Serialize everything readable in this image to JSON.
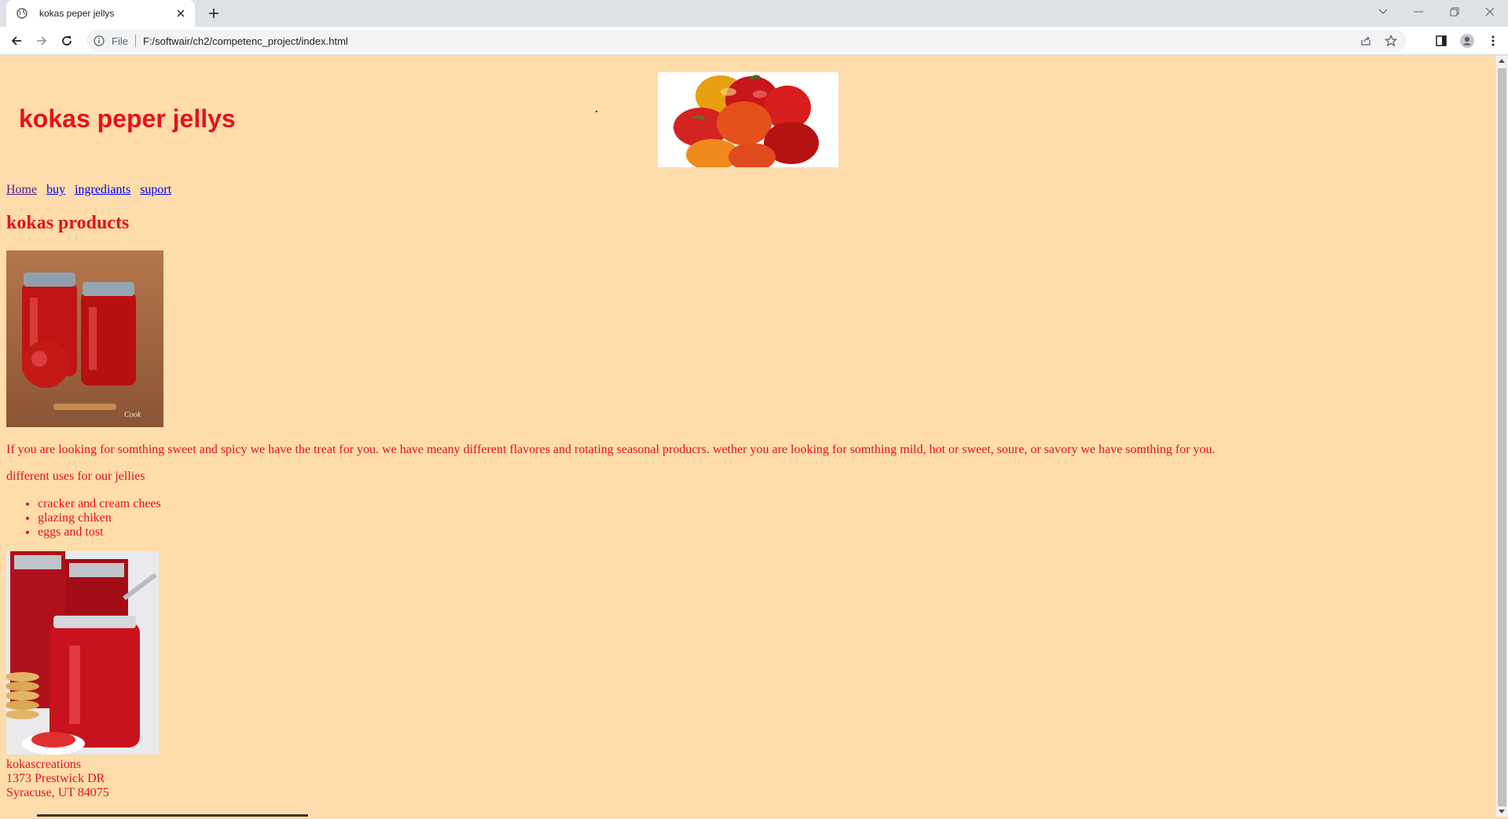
{
  "browser": {
    "tab_title": "kokas peper jellys",
    "url_scheme_label": "File",
    "url": "F:/softwair/ch2/competenc_project/index.html"
  },
  "page": {
    "site_title": "kokas peper jellys",
    "nav": [
      {
        "label": "Home"
      },
      {
        "label": "buy"
      },
      {
        "label": "ingrediants"
      },
      {
        "label": "suport"
      }
    ],
    "products_heading": "kokas products",
    "intro": "If you are looking for somthing sweet and spicy we have the treat for you. we have meany different flavores and rotating seasonal producrs. wether you are looking for somthing mild, hot or sweet, soure, or savory we have somthing for you.",
    "uses_heading": "different uses for our jellies",
    "uses": [
      "cracker and cream chees",
      "glazing chiken",
      "eggs and tost"
    ],
    "address": {
      "name": "kokascreations",
      "street": "1373 Prestwick DR",
      "city": "Syracuse, UT 84075"
    }
  },
  "colors": {
    "page_bg": "#fedcab",
    "text": "#e8101b",
    "link": "#0000ee",
    "visited_link": "#551a8b"
  },
  "icons": [
    "globe-icon",
    "close-icon",
    "plus-icon",
    "back-icon",
    "forward-icon",
    "reload-icon",
    "info-icon",
    "share-icon",
    "star-icon",
    "side-panel-icon",
    "profile-icon",
    "menu-icon",
    "chevron-down-icon",
    "minimize-icon",
    "restore-icon"
  ]
}
